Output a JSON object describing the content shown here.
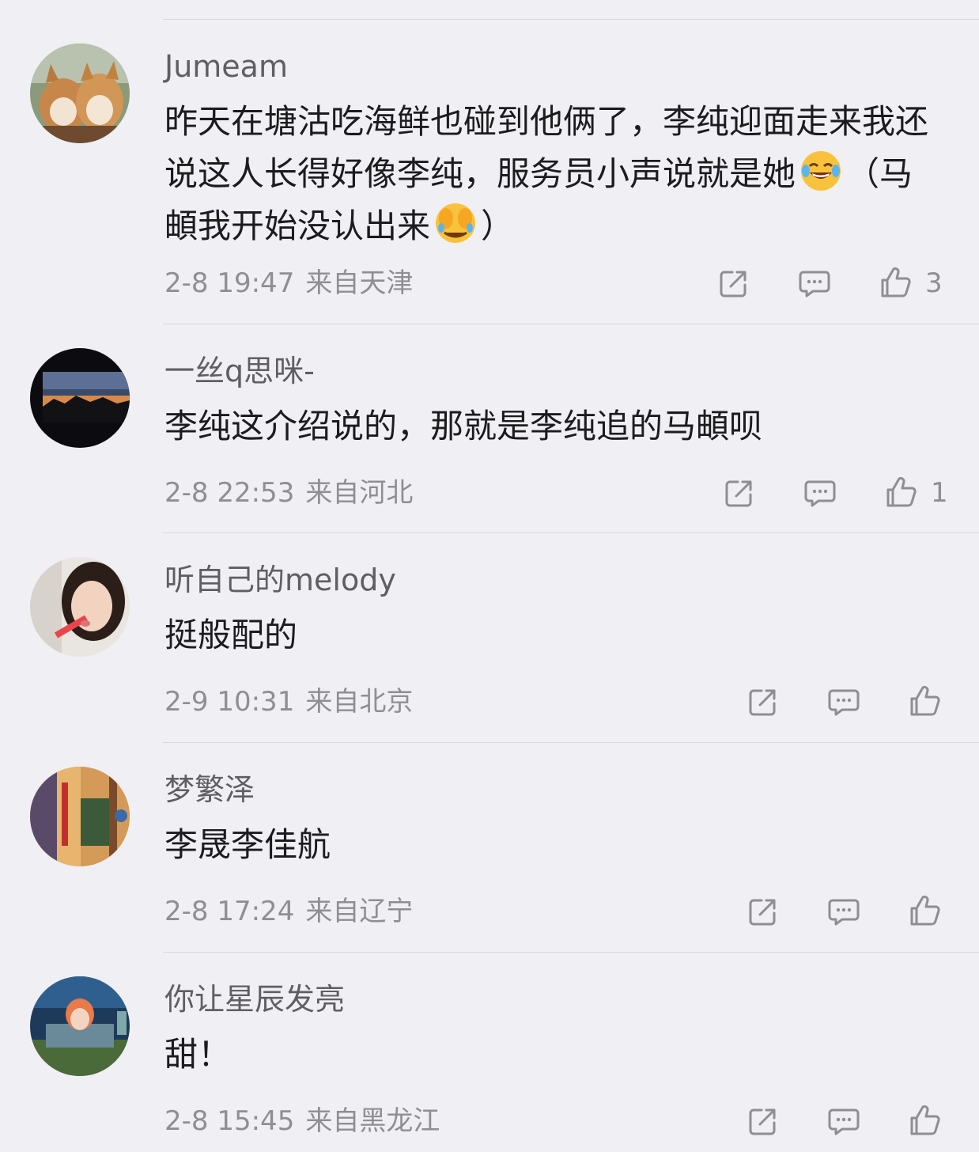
{
  "comments": [
    {
      "username": "Jumeam",
      "text": "昨天在塘沽吃海鲜也碰到他俩了，李纯迎面走来我还说这人长得好像李纯，服务员小声说就是她",
      "text_tail_1": "（马頔我开始没认出来",
      "text_tail_2": "）",
      "emoji_1": "laughing-tears-emoji",
      "emoji_2": "facepalm-crying-emoji",
      "time": "2-8 19:47",
      "location": "来自天津",
      "likes": "3"
    },
    {
      "username": "一丝q思咪-",
      "text": "李纯这介绍说的，那就是李纯追的马頔呗",
      "time": "2-8 22:53",
      "location": "来自河北",
      "likes": "1"
    },
    {
      "username": "听自己的melody",
      "text": "挺般配的",
      "time": "2-9 10:31",
      "location": "来自北京",
      "likes": ""
    },
    {
      "username": "梦繁泽",
      "text": "李晟李佳航",
      "time": "2-8 17:24",
      "location": "来自辽宁",
      "likes": ""
    },
    {
      "username": "你让星辰发亮",
      "text": "甜！",
      "time": "2-8 15:45",
      "location": "来自黑龙江",
      "likes": ""
    }
  ],
  "icons": {
    "share": "share-icon",
    "reply": "comment-bubble-icon",
    "like": "thumbs-up-icon"
  },
  "colors": {
    "background": "#f0eff4",
    "text": "#1c1c1e",
    "secondary": "#8e8e93",
    "divider": "#d9d8de"
  }
}
